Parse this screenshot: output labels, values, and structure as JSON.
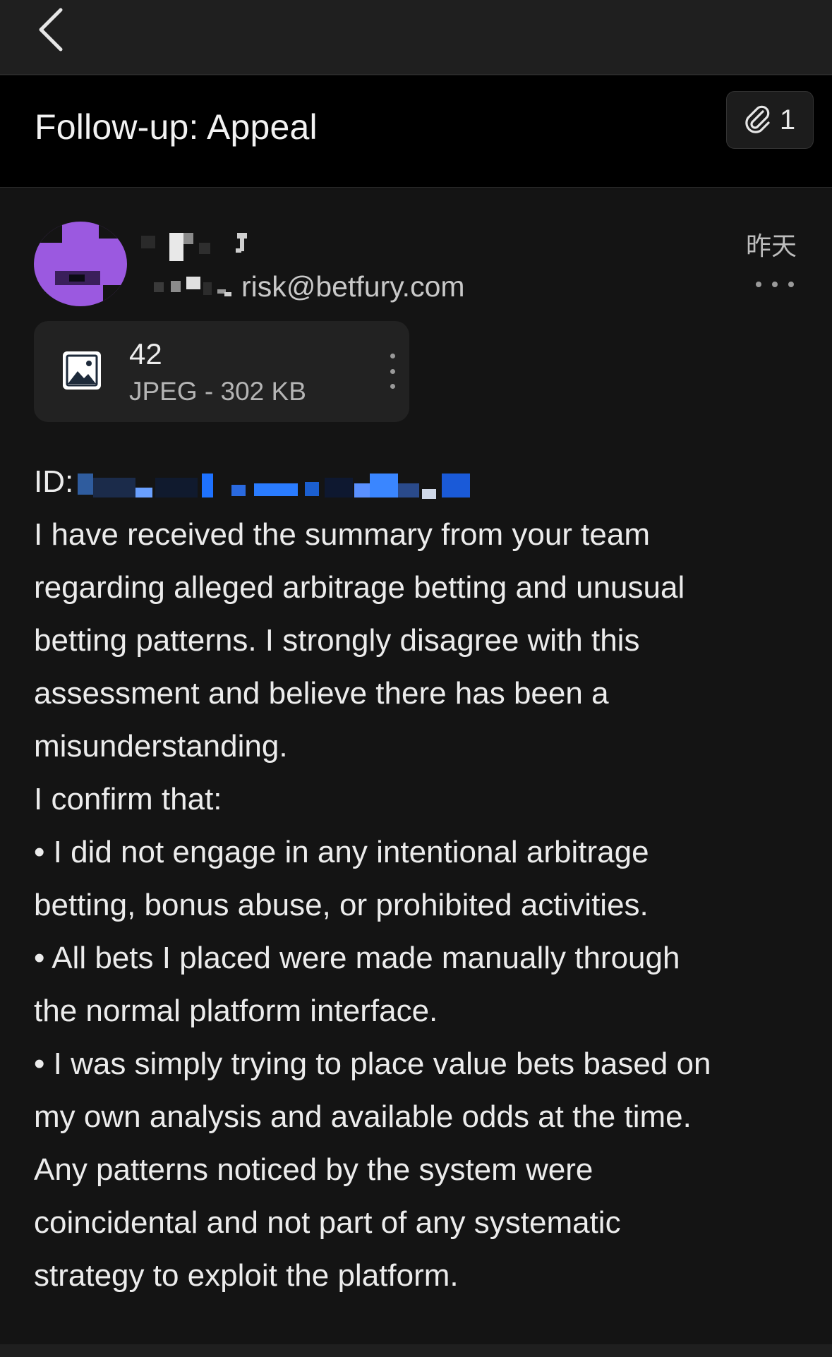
{
  "nav": {
    "back_icon": "chevron-left-icon"
  },
  "subject": {
    "title": "Follow-up: Appeal",
    "attachment_icon": "paperclip-icon",
    "attachment_count": "1"
  },
  "message": {
    "sender_email": "risk@betfury.com",
    "date": "昨天",
    "more_icon": "more-horizontal-icon",
    "attachment": {
      "name": "42",
      "meta": "JPEG - 302 KB",
      "icon": "image-icon",
      "menu_icon": "more-vertical-icon"
    },
    "body": {
      "id_label": "ID:",
      "lines": [
        "I have received the summary from your team",
        "regarding alleged arbitrage betting and unusual",
        "betting patterns. I strongly disagree with this",
        "assessment and believe there has been a",
        "misunderstanding.",
        "I confirm that:",
        "•  I did not engage in any intentional arbitrage",
        "betting, bonus abuse, or prohibited activities.",
        "•  All bets I placed were made manually through",
        "the normal platform interface.",
        "•  I was simply trying to place value bets based on",
        "my own analysis and available odds at the time.",
        "Any patterns noticed by the system were",
        "coincidental and not part of any systematic",
        "strategy to exploit the platform."
      ]
    }
  }
}
